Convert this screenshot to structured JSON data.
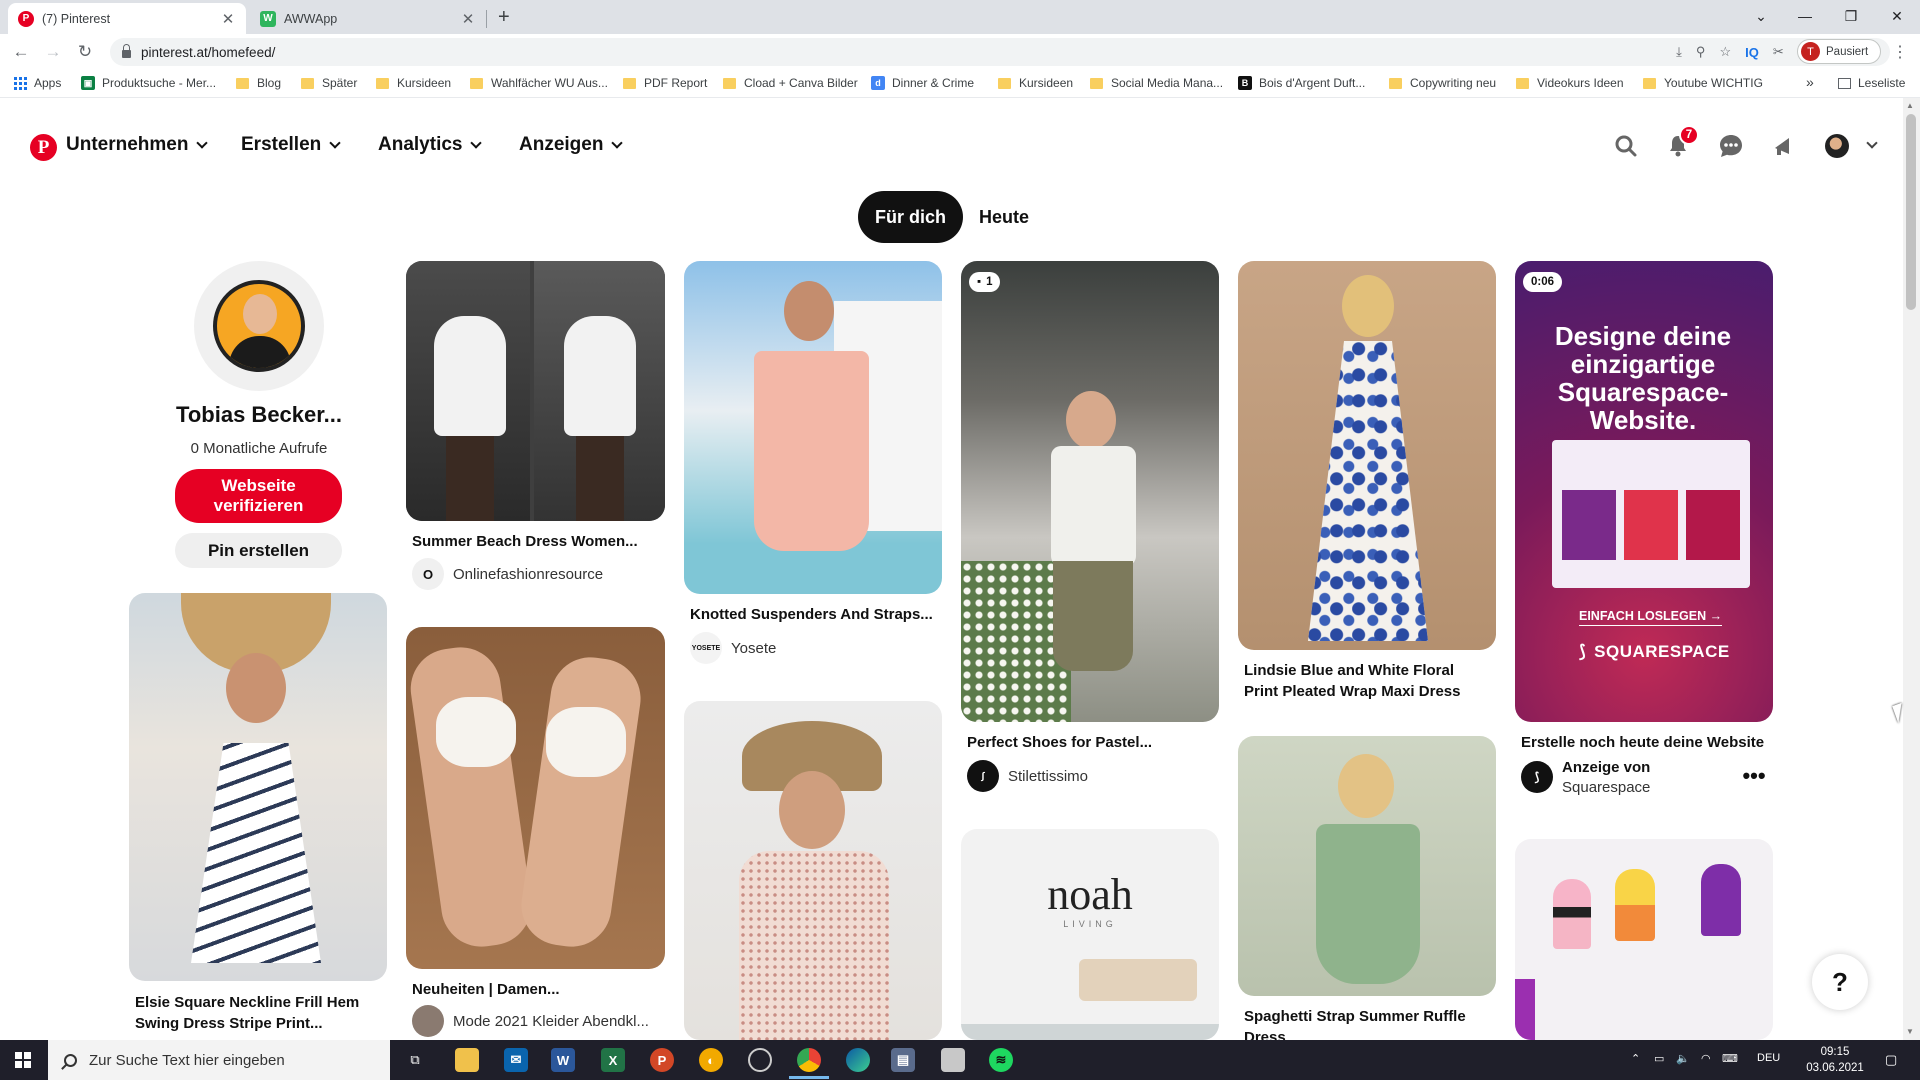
{
  "browser": {
    "tabs": [
      {
        "title": "(7) Pinterest",
        "active": true
      },
      {
        "title": "AWWApp",
        "active": false
      }
    ],
    "url": "pinterest.at/homefeed/",
    "profile_status": "Pausiert",
    "profile_initial": "T",
    "bookmarks": [
      {
        "label": "Apps",
        "icon": "apps-icon"
      },
      {
        "label": "Produktsuche - Mer...",
        "icon": "merchant-icon"
      },
      {
        "label": "Blog",
        "icon": "folder-icon"
      },
      {
        "label": "Später",
        "icon": "folder-icon"
      },
      {
        "label": "Kursideen",
        "icon": "folder-icon"
      },
      {
        "label": "Wahlfächer WU Aus...",
        "icon": "folder-icon"
      },
      {
        "label": "PDF Report",
        "icon": "folder-icon"
      },
      {
        "label": "Cload + Canva Bilder",
        "icon": "folder-icon"
      },
      {
        "label": "Dinner & Crime",
        "icon": "site-icon"
      },
      {
        "label": "Kursideen",
        "icon": "folder-icon"
      },
      {
        "label": "Social Media Mana...",
        "icon": "folder-icon"
      },
      {
        "label": "Bois d'Argent Duft...",
        "icon": "site-icon"
      },
      {
        "label": "Copywriting neu",
        "icon": "folder-icon"
      },
      {
        "label": "Videokurs Ideen",
        "icon": "folder-icon"
      },
      {
        "label": "Youtube WICHTIG",
        "icon": "folder-icon"
      }
    ],
    "more_bookmarks": "»",
    "reading_list": "Leseliste"
  },
  "pinterest": {
    "brand_color": "#e60023",
    "nav": [
      "Unternehmen",
      "Erstellen",
      "Analytics",
      "Anzeigen"
    ],
    "notification_count": "7",
    "feed_tabs": [
      "Für dich",
      "Heute"
    ],
    "profile": {
      "name": "Tobias Becker...",
      "views": "0 Monatliche Aufrufe",
      "verify_button": "Webseite verifizieren",
      "create_pin_button": "Pin erstellen"
    },
    "pins": [
      {
        "id": "p1",
        "title": "Summer Beach Dress Women...",
        "source": "Onlinefashionresource",
        "source_avatar": "O"
      },
      {
        "id": "p2",
        "title": "Knotted Suspenders And Straps...",
        "source": "Yosete",
        "source_avatar": "YOSETE"
      },
      {
        "id": "p3",
        "title": "Perfect Shoes for Pastel...",
        "source": "Stilettissimo",
        "chip": "1"
      },
      {
        "id": "p4",
        "title": "Lindsie Blue and White Floral Print Pleated Wrap Maxi Dress"
      },
      {
        "id": "p5",
        "title": "Erstelle noch heute deine Website",
        "ad_by": "Anzeige von",
        "source": "Squarespace",
        "chip": "0:06",
        "ad_headline": "Designe deine einzigartige Squarespace-Website.",
        "ad_cta": "EINFACH LOSLEGEN →",
        "ad_brand": "SQUARESPACE"
      },
      {
        "id": "p6",
        "title": "Elsie Square Neckline Frill Hem Swing Dress Stripe Print..."
      },
      {
        "id": "p7",
        "title": "Neuheiten | Damen...",
        "source": "Mode 2021 Kleider Abendkl..."
      },
      {
        "id": "p8",
        "title": "Spaghetti Strap Summer Ruffle Dress"
      },
      {
        "id": "p9",
        "brand_text": "noah",
        "brand_sub": "LIVING"
      }
    ],
    "more_button": "•••",
    "help_button": "?"
  },
  "taskbar": {
    "search_placeholder": "Zur Suche Text hier eingeben",
    "language": "DEU",
    "time": "09:15",
    "date": "03.06.2021"
  }
}
